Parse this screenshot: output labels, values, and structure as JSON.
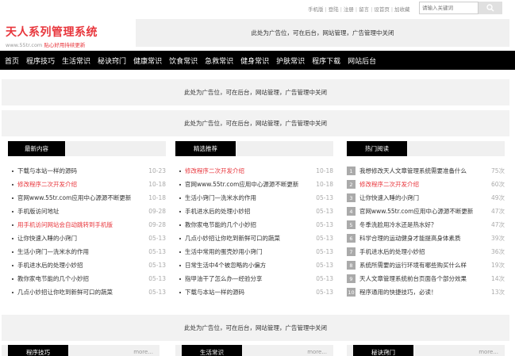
{
  "toplinks": [
    "手机版",
    "登陆",
    "注册",
    "留言",
    "设首页",
    "加收藏"
  ],
  "search": {
    "placeholder": "请输入关键词"
  },
  "logo": {
    "title": "天人系列管理系统",
    "url_text": "www.55tr.com",
    "slogan": "贴心好用持续更新"
  },
  "ad_text": "此处为广告位，可在后台，网站管理，广告管理中关闭",
  "nav": [
    "首页",
    "程序技巧",
    "生活常识",
    "秘诀窍门",
    "健康常识",
    "饮食常识",
    "急救常识",
    "健身常识",
    "护肤常识",
    "程序下载",
    "网站后台"
  ],
  "columns": [
    {
      "title": "最新内容",
      "items": [
        {
          "title": "下载与本站一样的源码",
          "date": "10-23",
          "red": false
        },
        {
          "title": "修改程序二次开发介绍",
          "date": "10-18",
          "red": true
        },
        {
          "title": "官网www.55tr.com应用中心源源不断更新",
          "date": "10-18",
          "red": false
        },
        {
          "title": "手机版访问地址",
          "date": "09-28",
          "red": false
        },
        {
          "title": "用手机访问网站会自动跳转到手机版",
          "date": "09-28",
          "red": true
        },
        {
          "title": "让你快速入睡的小窍门",
          "date": "05-13",
          "red": false
        },
        {
          "title": "生活小窍门—洗米水的作用",
          "date": "05-13",
          "red": false
        },
        {
          "title": "手机进水后的处理小妙招",
          "date": "05-13",
          "red": false
        },
        {
          "title": "教你家电节能的几个小妙招",
          "date": "05-13",
          "red": false
        },
        {
          "title": "几点小妙招让你吃到新鲜可口的蔬菜",
          "date": "05-13",
          "red": false
        }
      ]
    },
    {
      "title": "精选推荐",
      "items": [
        {
          "title": "修改程序二次开发介绍",
          "date": "10-18",
          "red": true
        },
        {
          "title": "官网www.55tr.com应用中心源源不断更新",
          "date": "10-18",
          "red": false
        },
        {
          "title": "生活小窍门—洗米水的作用",
          "date": "05-13",
          "red": false
        },
        {
          "title": "手机进水后的处理小妙招",
          "date": "05-13",
          "red": false
        },
        {
          "title": "教你家电节能的几个小妙招",
          "date": "05-13",
          "red": false
        },
        {
          "title": "几点小妙招让你吃到新鲜可口的蔬菜",
          "date": "05-13",
          "red": false
        },
        {
          "title": "生活中常用的蛋壳妙用小窍门",
          "date": "05-13",
          "red": false
        },
        {
          "title": "日常生活中4个被忽略的小偏方",
          "date": "05-13",
          "red": false
        },
        {
          "title": "指甲油干了怎么办—经验分享",
          "date": "05-13",
          "red": false
        },
        {
          "title": "下载与本站一样的源码",
          "date": "05-13",
          "red": false
        }
      ]
    },
    {
      "title": "热门阅读",
      "items": [
        {
          "num": "1",
          "title": "我想修改天人文章管理系统需要准备什么",
          "date": "75次",
          "red": false
        },
        {
          "num": "2",
          "title": "修改程序二次开发介绍",
          "date": "60次",
          "red": true
        },
        {
          "num": "3",
          "title": "让你快速入睡的小窍门",
          "date": "49次",
          "red": false
        },
        {
          "num": "4",
          "title": "官网www.55tr.com应用中心源源不断更新",
          "date": "47次",
          "red": false
        },
        {
          "num": "5",
          "title": "冬季洗脸用冷水还是热水好？",
          "date": "47次",
          "red": false
        },
        {
          "num": "6",
          "title": "科学合理的运动健身才能提高身体素质",
          "date": "39次",
          "red": false
        },
        {
          "num": "7",
          "title": "手机进水后的处理小妙招",
          "date": "36次",
          "red": false
        },
        {
          "num": "8",
          "title": "系统所需要的运行环境有哪些购买什么样",
          "date": "19次",
          "red": false
        },
        {
          "num": "9",
          "title": "天人文章管理系统前台页面各个部分效果",
          "date": "14次",
          "red": false
        },
        {
          "num": "10",
          "title": "程序通用的快捷技巧，必读！",
          "date": "13次",
          "red": false
        }
      ]
    }
  ],
  "more_sections": [
    {
      "title": "程序技巧",
      "more": "more..."
    },
    {
      "title": "生活常识",
      "more": "more..."
    },
    {
      "title": "秘诀窍门",
      "more": "more..."
    }
  ],
  "colors": {
    "accent": "#e8363c",
    "nav_bg": "#000000",
    "panel_bg": "#f0f0f0"
  }
}
